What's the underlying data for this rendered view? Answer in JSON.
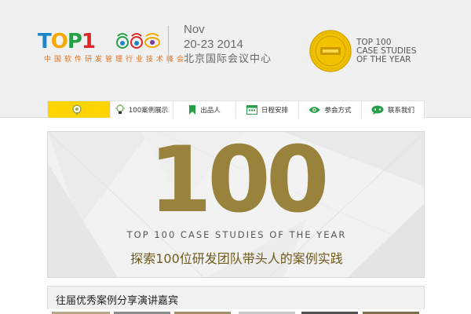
{
  "header": {
    "logo_text": {
      "t": "T",
      "o": "O",
      "p": "P",
      "one": "1"
    },
    "logo_subtitle": "中国软件研发管理行业技术峰会",
    "date_month": "Nov",
    "date_range": "20-23 2014",
    "date_place": "北京国际会议中心",
    "seal_caption": [
      "TOP 100",
      "CASE STUDIES",
      "OF THE YEAR"
    ]
  },
  "nav": {
    "items": [
      {
        "label": "",
        "icon": "location-pin-icon",
        "active": true
      },
      {
        "label": "100案例展示",
        "icon": "lightbulb-icon",
        "active": false
      },
      {
        "label": "出品人",
        "icon": "bookmark-icon",
        "active": false
      },
      {
        "label": "日程安排",
        "icon": "calendar-icon",
        "active": false
      },
      {
        "label": "参会方式",
        "icon": "eye-icon",
        "active": false
      },
      {
        "label": "联系我们",
        "icon": "chat-icon",
        "active": false
      }
    ]
  },
  "banner": {
    "number": "100",
    "subtitle_en": "TOP 100 CASE STUDIES OF THE YEAR",
    "subtitle_cn": "探索100位研发团队带头人的案例实践"
  },
  "section": {
    "title": "往届优秀案例分享演讲嘉宾"
  },
  "colors": {
    "accent": "#ffd400",
    "gold": "#98823c",
    "topbar": "#f0f0f0"
  }
}
